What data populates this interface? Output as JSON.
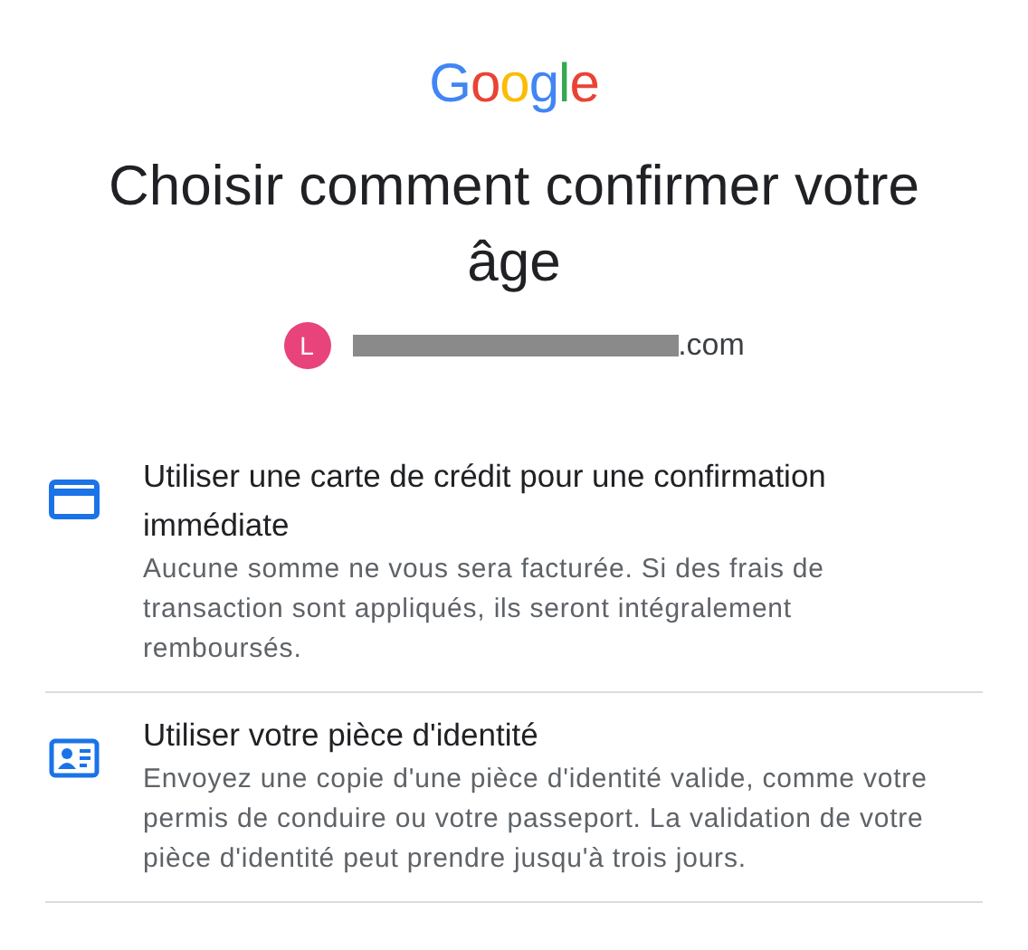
{
  "logo": {
    "text": "Google"
  },
  "title": "Choisir comment confirmer votre âge",
  "account": {
    "initial": "L",
    "email_visible": ".com",
    "redacted": true
  },
  "options": [
    {
      "kind": "card",
      "title": "Utiliser une carte de crédit pour une confirmation immédiate",
      "description": "Aucune somme ne vous sera facturée. Si des frais de transaction sont appliqués, ils seront intégralement remboursés."
    },
    {
      "kind": "id",
      "title": "Utiliser votre pièce d'identité",
      "description": "Envoyez une copie d'une pièce d'identité valide, comme votre permis de conduire ou votre passeport. La validation de votre pièce d'identité peut prendre jusqu'à trois jours."
    }
  ]
}
